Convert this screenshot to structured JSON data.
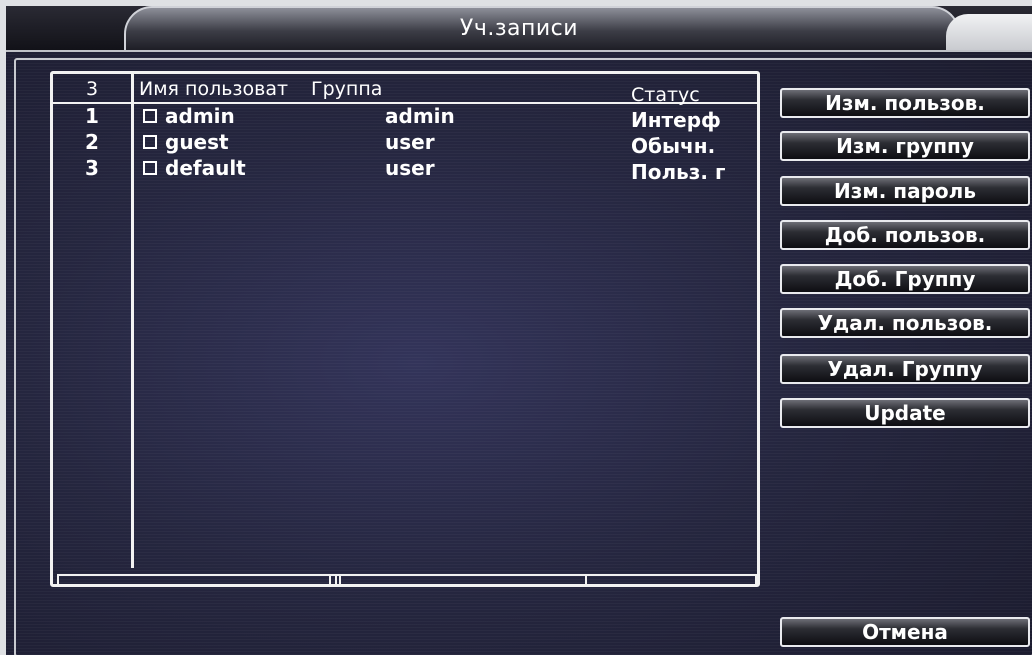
{
  "window": {
    "title": "Уч.записи"
  },
  "table": {
    "header": {
      "count": "3",
      "name": "Имя пользоват",
      "group": "Группа",
      "status": "Статус"
    },
    "rows": [
      {
        "num": "1",
        "name": "admin",
        "group": "admin",
        "status": "Интерф"
      },
      {
        "num": "2",
        "name": "guest",
        "group": "user",
        "status": "Обычн."
      },
      {
        "num": "3",
        "name": "default",
        "group": "user",
        "status": "Польз. г"
      }
    ]
  },
  "buttons": {
    "edit_user": "Изм. пользов.",
    "edit_group": "Изм. группу",
    "edit_password": "Изм. пароль",
    "add_user": "Доб. пользов.",
    "add_group": "Доб. Группу",
    "delete_user": "Удал. пользов.",
    "delete_group": "Удал. Группу",
    "update": "Update",
    "cancel": "Отмена"
  },
  "colors": {
    "background": "#25263f",
    "text": "#ffffff",
    "border": "#f2f2f2"
  }
}
